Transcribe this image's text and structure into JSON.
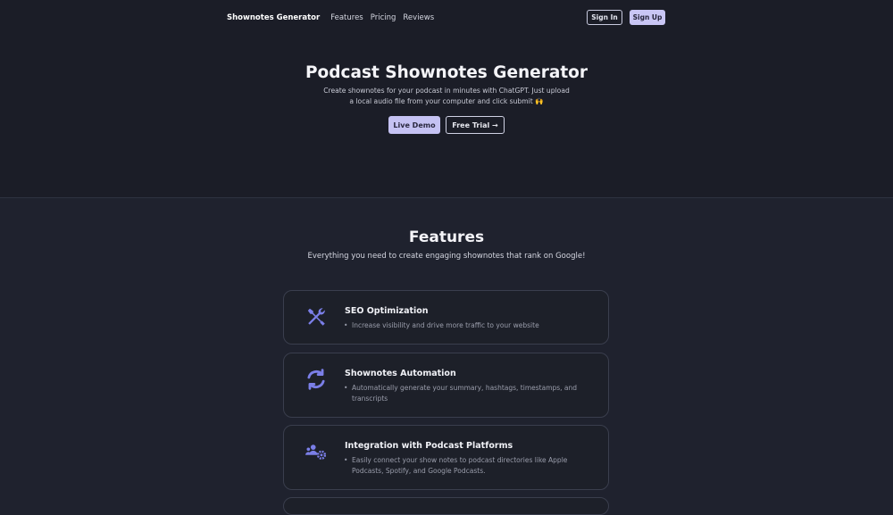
{
  "nav": {
    "brand": "Shownotes Generator",
    "links": [
      "Features",
      "Pricing",
      "Reviews"
    ],
    "sign_in": "Sign In",
    "sign_up": "Sign Up"
  },
  "hero": {
    "title": "Podcast Shownotes Generator",
    "subtitle": "Create shownotes for your podcast in minutes with ChatGPT. Just upload a local audio file from your computer and click submit 🙌",
    "live_demo": "Live Demo",
    "free_trial": "Free Trial →"
  },
  "features": {
    "title": "Features",
    "subtitle": "Everything you need to create engaging shownotes that rank on Google!",
    "items": [
      {
        "icon": "tools-icon",
        "title": "SEO Optimization",
        "desc": "Increase visibility and drive more traffic to your website"
      },
      {
        "icon": "refresh-icon",
        "title": "Shownotes Automation",
        "desc": "Automatically generate your summary, hashtags, timestamps, and transcripts"
      },
      {
        "icon": "users-gear-icon",
        "title": "Integration with Podcast Platforms",
        "desc": "Easily connect your show notes to podcast directories like Apple Podcasts, Spotify, and Google Podcasts."
      }
    ]
  },
  "colors": {
    "accent": "#c9c6f5",
    "icon": "#7b7fe8",
    "background": "#1f222e"
  }
}
